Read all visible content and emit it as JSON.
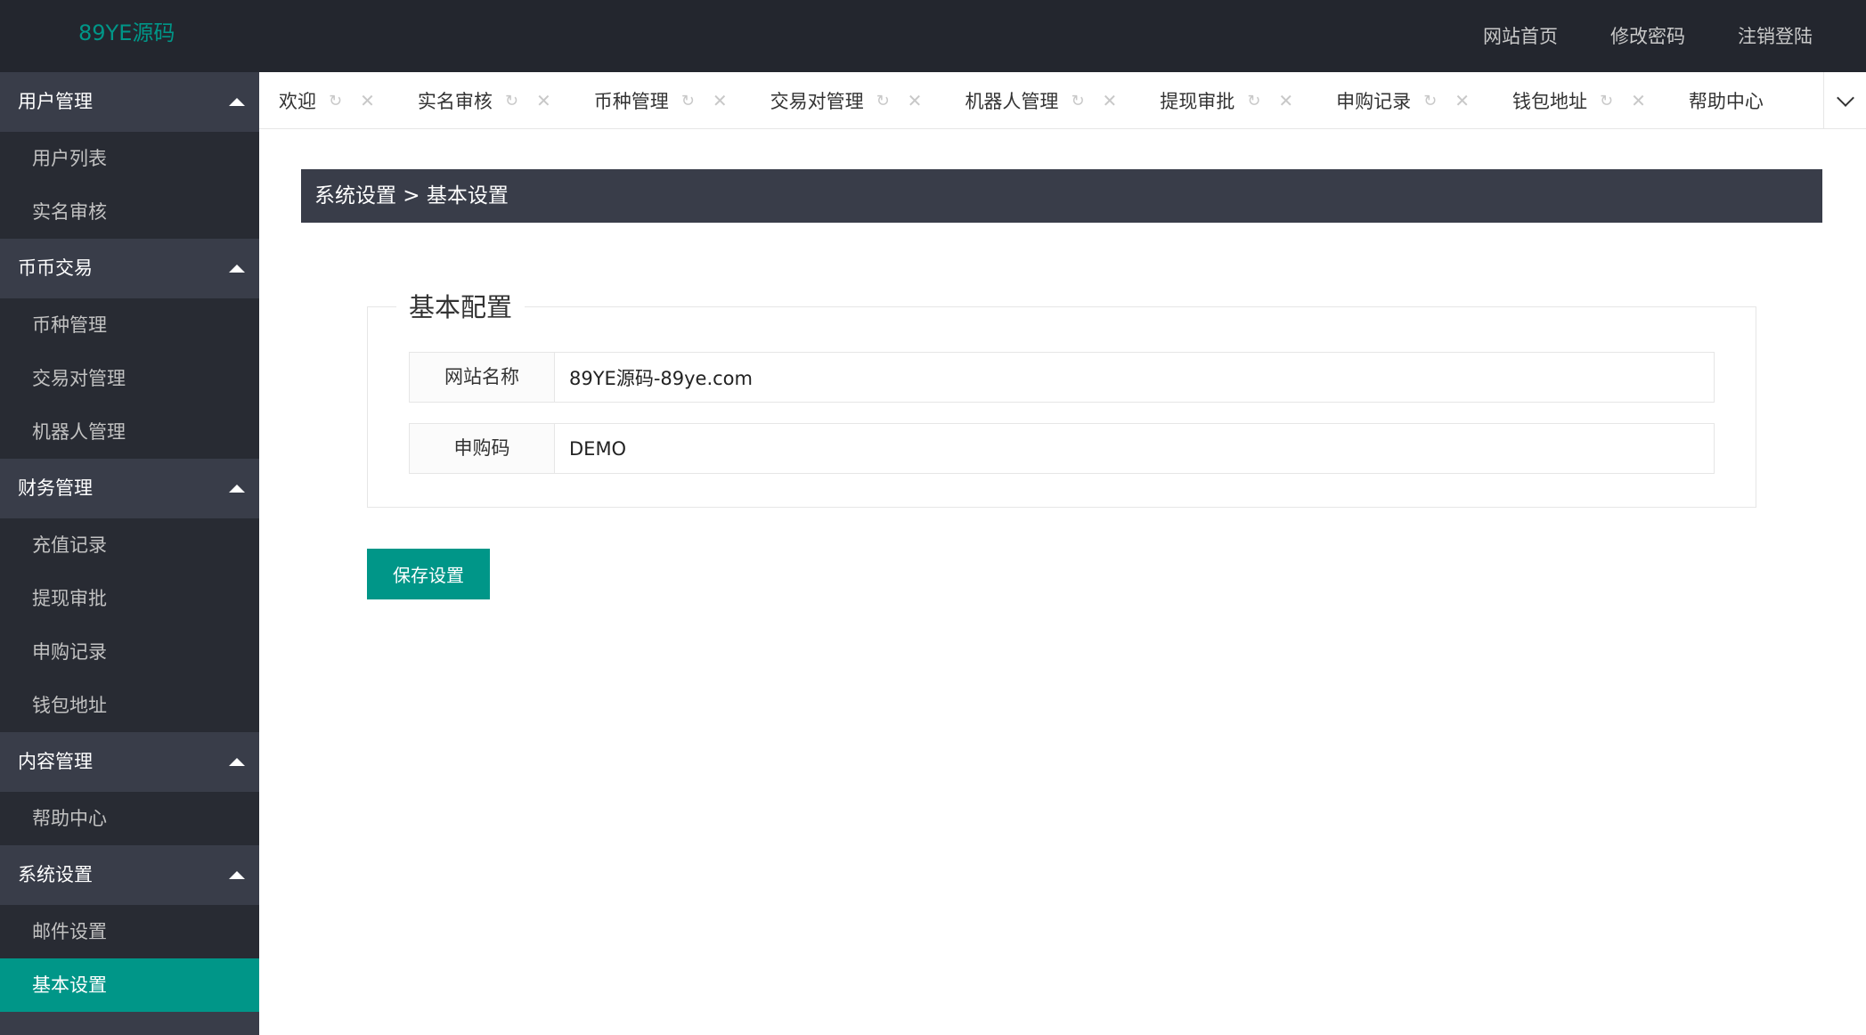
{
  "header": {
    "logo": "89YE源码",
    "nav": [
      "网站首页",
      "修改密码",
      "注销登陆"
    ]
  },
  "sidebar": {
    "groups": [
      {
        "title": "用户管理",
        "items": [
          "用户列表",
          "实名审核"
        ]
      },
      {
        "title": "币币交易",
        "items": [
          "币种管理",
          "交易对管理",
          "机器人管理"
        ]
      },
      {
        "title": "财务管理",
        "items": [
          "充值记录",
          "提现审批",
          "申购记录",
          "钱包地址"
        ]
      },
      {
        "title": "内容管理",
        "items": [
          "帮助中心"
        ]
      },
      {
        "title": "系统设置",
        "items": [
          "邮件设置",
          "基本设置"
        ]
      }
    ],
    "active_item": "基本设置"
  },
  "tabs": {
    "items": [
      "欢迎",
      "实名审核",
      "币种管理",
      "交易对管理",
      "机器人管理",
      "提现审批",
      "申购记录",
      "钱包地址",
      "帮助中心"
    ],
    "refresh_icon": "refresh-icon",
    "close_icon": "close-icon",
    "dropdown_icon": "chevron-down-icon"
  },
  "breadcrumb": "系统设置 > 基本设置",
  "form": {
    "legend": "基本配置",
    "site_name_label": "网站名称",
    "site_name_value": "89YE源码-89ye.com",
    "purchase_code_label": "申购码",
    "purchase_code_value": "DEMO",
    "save_label": "保存设置"
  },
  "colors": {
    "accent": "#009688",
    "header_bg": "#23262e",
    "sidebar_bg": "#393d49",
    "submenu_bg": "#282b33"
  }
}
